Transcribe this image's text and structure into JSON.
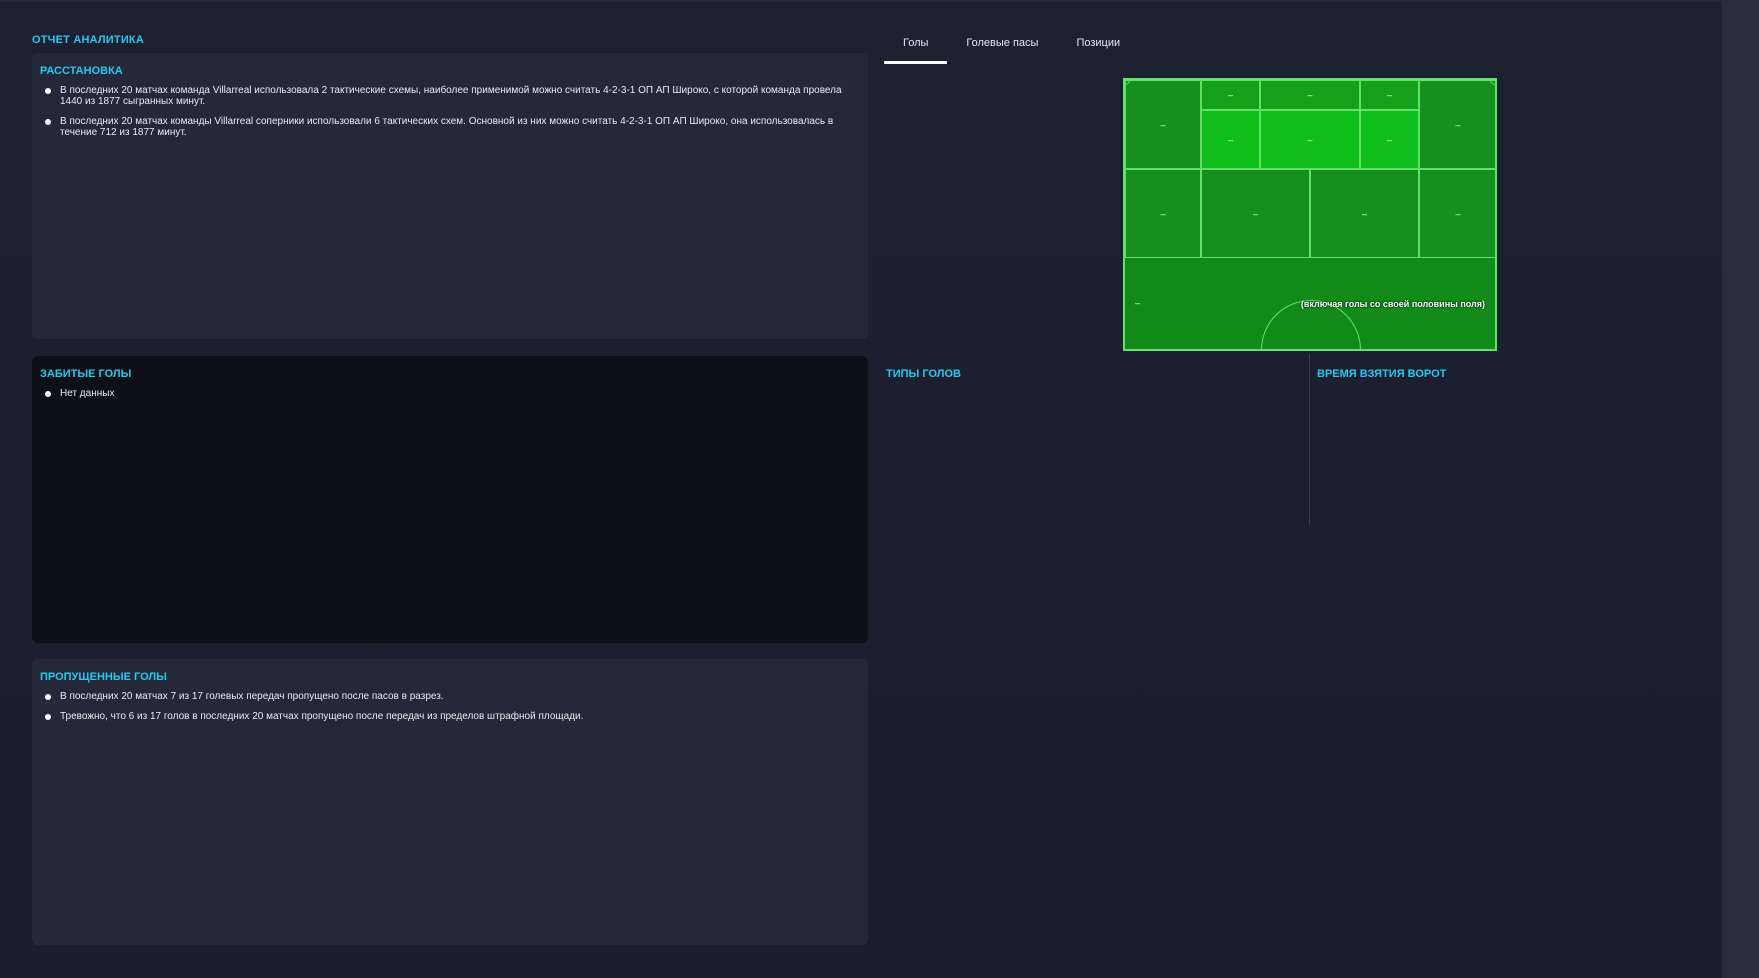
{
  "report": {
    "title": "ОТЧЕТ АНАЛИТИКА"
  },
  "formation": {
    "title": "РАССТАНОВКА",
    "items": [
      "В последних 20 матчах команда Villarreal использовала 2 тактические схемы, наиболее применимой можно считать 4-2-3-1 ОП АП Широко, с которой команда провела 1440 из 1877 сыгранных минут.",
      "В последних 20 матчах команды Villarreal соперники использовали 6 тактических схем. Основной из них можно считать 4-2-3-1 ОП АП Широко, она использовалась в течение 712 из 1877 минут."
    ]
  },
  "scored": {
    "title": "ЗАБИТЫЕ ГОЛЫ",
    "items": [
      "Нет данных"
    ]
  },
  "conceded": {
    "title": "ПРОПУЩЕННЫЕ ГОЛЫ",
    "items": [
      "В последних 20 матчах 7 из 17 голевых передач пропущено после пасов в разрез.",
      "Тревожно, что 6 из 17 голов в последних 20 матчах пропущено после передач из пределов штрафной площади."
    ]
  },
  "tabs": [
    {
      "label": "Голы",
      "active": true
    },
    {
      "label": "Голевые пасы",
      "active": false
    },
    {
      "label": "Позиции",
      "active": false
    }
  ],
  "pitch": {
    "zones": {
      "six_left": "–",
      "six_center": "–",
      "six_right": "–",
      "wide_left": "–",
      "wide_right": "–",
      "box_left": "–",
      "box_center": "–",
      "box_right": "–",
      "mid_left_wing": "–",
      "mid_left": "–",
      "mid_right": "–",
      "mid_right_wing": "–",
      "own_half": "–"
    },
    "note": "(включая голы со своей половины поля)"
  },
  "goal_types": {
    "title": "ТИПЫ ГОЛОВ"
  },
  "goal_times": {
    "title": "ВРЕМЯ ВЗЯТИЯ ВОРОТ"
  },
  "colors": {
    "accent": "#27c8f0",
    "background": "#1b1e2d",
    "panel": "#242838",
    "pitch": "#128a1a",
    "pitch_lines": "#62e06a"
  }
}
